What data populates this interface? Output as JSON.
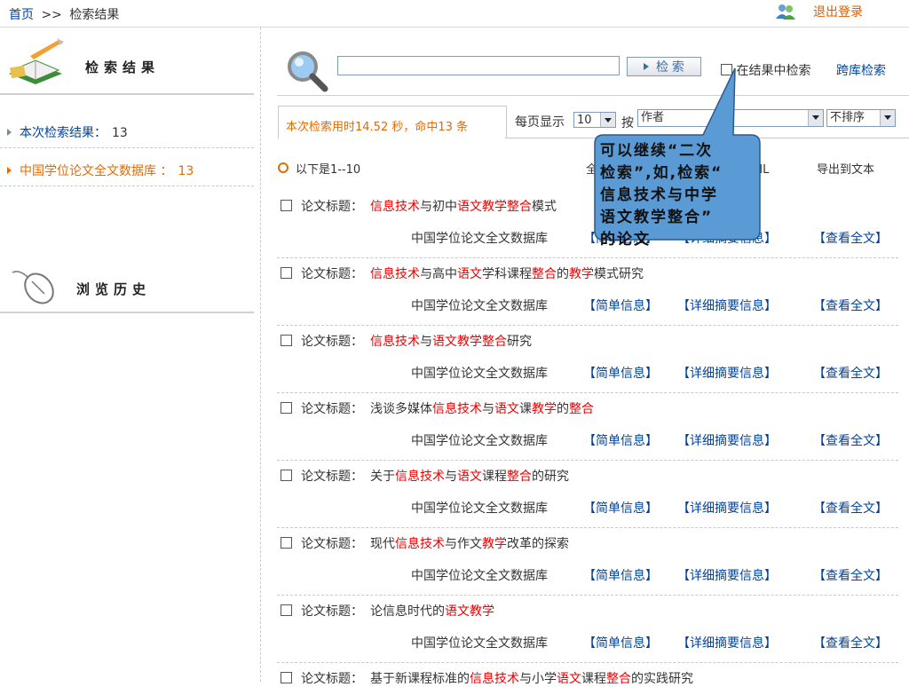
{
  "topbar": {
    "home": "首页",
    "separator": ">>",
    "current": "检索结果",
    "logout": "退出登录"
  },
  "sidebar": {
    "results_header": "检索结果",
    "items": [
      {
        "label": "本次检索结果：",
        "count": "13"
      },
      {
        "label": "中国学位论文全文数据库 ：",
        "count": "13"
      }
    ],
    "history_header": "浏览历史"
  },
  "search": {
    "input_value": "",
    "button_label": "检 索",
    "in_result_label": "在结果中检索",
    "cross_db_label": "跨库检索"
  },
  "status": {
    "summary": "本次检索用时14.52 秒，命中13 条",
    "per_page_label": "每页显示",
    "per_page_value": "10",
    "by_label": "按",
    "field_value": "作者",
    "sort_value": "不排序"
  },
  "listing": {
    "range": "以下是1--10",
    "partial_label": "全",
    "export_xml": "到XML",
    "export_text": "导出到文本"
  },
  "results": [
    {
      "prefix": "论文标题：",
      "segments": [
        [
          "信息技术",
          true
        ],
        [
          "与初中",
          false
        ],
        [
          "语文教学整合",
          true
        ],
        [
          "模式",
          false
        ]
      ]
    },
    {
      "prefix": "论文标题：",
      "segments": [
        [
          "信息技术",
          true
        ],
        [
          "与高中",
          false
        ],
        [
          "语文",
          true
        ],
        [
          "学科课程",
          false
        ],
        [
          "整合",
          true
        ],
        [
          "的",
          false
        ],
        [
          "教学",
          true
        ],
        [
          "模式研究",
          false
        ]
      ]
    },
    {
      "prefix": "论文标题：",
      "segments": [
        [
          "信息技术",
          true
        ],
        [
          "与",
          false
        ],
        [
          "语文教学整合",
          true
        ],
        [
          "研究",
          false
        ]
      ]
    },
    {
      "prefix": "论文标题：",
      "segments": [
        [
          "浅谈多媒体",
          false
        ],
        [
          "信息技术",
          true
        ],
        [
          "与",
          false
        ],
        [
          "语文",
          true
        ],
        [
          "课",
          false
        ],
        [
          "教学",
          true
        ],
        [
          "的",
          false
        ],
        [
          "整合",
          true
        ]
      ]
    },
    {
      "prefix": "论文标题：",
      "segments": [
        [
          "关于",
          false
        ],
        [
          "信息技术",
          true
        ],
        [
          "与",
          false
        ],
        [
          "语文",
          true
        ],
        [
          "课程",
          false
        ],
        [
          "整合",
          true
        ],
        [
          "的研究",
          false
        ]
      ]
    },
    {
      "prefix": "论文标题：",
      "segments": [
        [
          "现代",
          false
        ],
        [
          "信息技术",
          true
        ],
        [
          "与作文",
          false
        ],
        [
          "教学",
          true
        ],
        [
          "改革的探索",
          false
        ]
      ]
    },
    {
      "prefix": "论文标题：",
      "segments": [
        [
          "论信息时代的",
          false
        ],
        [
          "语文教学",
          true
        ]
      ]
    },
    {
      "prefix": "论文标题：",
      "segments": [
        [
          "基于新课程标准的",
          false
        ],
        [
          "信息技术",
          true
        ],
        [
          "与小学",
          false
        ],
        [
          "语文",
          true
        ],
        [
          "课程",
          false
        ],
        [
          "整合",
          true
        ],
        [
          "的实践研究",
          false
        ]
      ]
    }
  ],
  "row_links": {
    "database": "中国学位论文全文数据库",
    "brief": "【简单信息】",
    "abstract": "【详细摘要信息】",
    "fulltext": "【查看全文】"
  },
  "callout": {
    "lines": [
      "可以继续“二次",
      "检索”,如,检索“",
      "信息技术与中学",
      "语文教学整合”",
      "的论文"
    ]
  }
}
